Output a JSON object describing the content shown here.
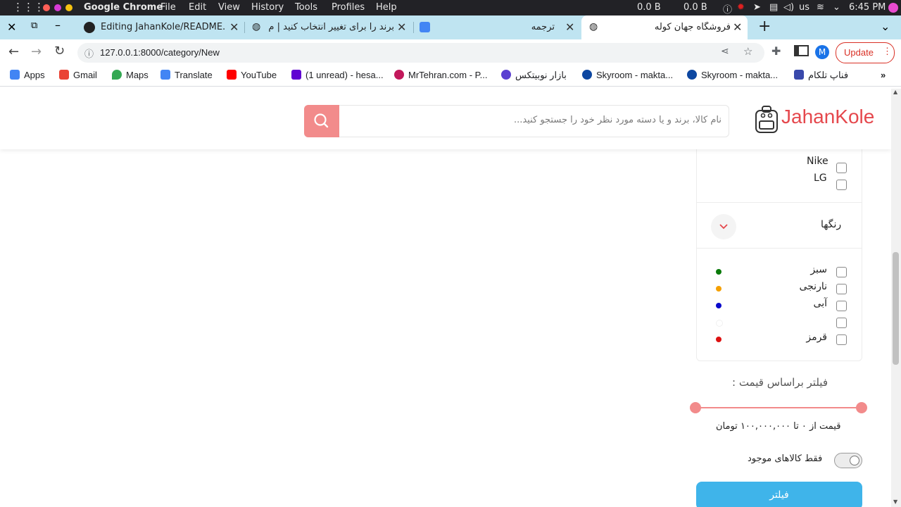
{
  "os": {
    "app_name": "Google Chrome",
    "menu": [
      "File",
      "Edit",
      "View",
      "History",
      "Tools",
      "Profiles",
      "Help"
    ],
    "net_down": "0.0 B",
    "net_up": "0.0 B",
    "keyboard": "us",
    "clock": "6:45 PM"
  },
  "tabs": [
    {
      "title": "Editing JahanKole/README.m"
    },
    {
      "title": "برند را برای تغییر انتخاب کنید | م"
    },
    {
      "title": "ترجمه"
    },
    {
      "title": "فروشگاه جهان کوله"
    }
  ],
  "address": {
    "url": "127.0.0.1:8000/category/New"
  },
  "profile_initial": "M",
  "update_label": "Update",
  "bookmarks": [
    {
      "label": "Apps",
      "color": "#4285f4"
    },
    {
      "label": "Gmail",
      "color": "#ea4335"
    },
    {
      "label": "Maps",
      "color": "#34a853"
    },
    {
      "label": "Translate",
      "color": "#4285f4"
    },
    {
      "label": "YouTube",
      "color": "#ff0000"
    },
    {
      "label": "(1 unread) - hesa...",
      "color": "#6001d2"
    },
    {
      "label": "MrTehran.com - P...",
      "color": "#c2185b"
    },
    {
      "label": "بازار نوبیتکس",
      "color": "#5a3fd1"
    },
    {
      "label": "Skyroom - makta...",
      "color": "#0d47a1"
    },
    {
      "label": "Skyroom - makta...",
      "color": "#0d47a1"
    },
    {
      "label": "فناپ تلکام",
      "color": "#3949ab"
    }
  ],
  "site": {
    "logo": "JahanKole",
    "search_placeholder": "نام کالا، برند و یا دسته مورد نظر خود را جستجو کنید...",
    "brands": [
      "Nike",
      "LG"
    ],
    "colors_title": "رنگها",
    "colors": [
      {
        "name": "سبز",
        "hex": "#0a7a0a"
      },
      {
        "name": "نارنجی",
        "hex": "#f5a000"
      },
      {
        "name": "آبی",
        "hex": "#0a0acc"
      },
      {
        "name": "",
        "hex": "#ffffff"
      },
      {
        "name": "قرمز",
        "hex": "#dd1111"
      }
    ],
    "price_title": "فیلتر براساس قیمت :",
    "price_range": "قیمت از ۰ تا ۱۰۰,۰۰۰,۰۰۰ تومان",
    "price_min_fraction": 0,
    "price_max_fraction": 1,
    "in_stock_label": "فقط کالاهای موجود",
    "filter_button": "فیلتر",
    "accent": "#f28b8b",
    "button_color": "#3fb4ea"
  }
}
